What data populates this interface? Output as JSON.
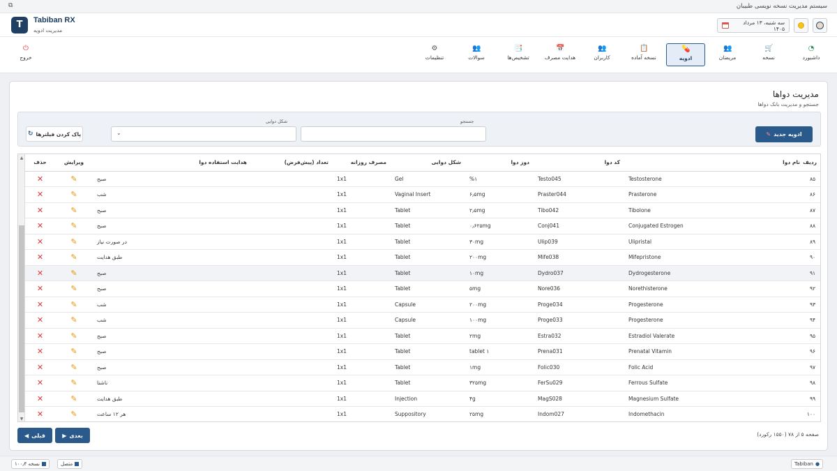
{
  "window": {
    "title": "سیستم مدیریت نسخه نویسی طبیبان",
    "restore_glyph": "⧉"
  },
  "app": {
    "logo_letter": "T",
    "name": "Tabiban RX",
    "subtitle": "مدیریت ادویه"
  },
  "header": {
    "date": "سه شنبه، ۱۳ مرداد ۱۴۰۵"
  },
  "nav": {
    "items": [
      {
        "label": "داشبورد",
        "icon": "gauge-icon",
        "glyph": "◔",
        "color": "#2a8a5a"
      },
      {
        "label": "نسخه",
        "icon": "cart-icon",
        "glyph": "🛒",
        "color": "#2a8a5a"
      },
      {
        "label": "مریضان",
        "icon": "patients-icon",
        "glyph": "👥",
        "color": "#b07a2a"
      },
      {
        "label": "ادویه",
        "icon": "pill-icon",
        "glyph": "💊",
        "color": "#d9534f",
        "active": true
      },
      {
        "label": "نسخه آماده",
        "icon": "prescription-icon",
        "glyph": "📋",
        "color": "#4a6fa5"
      },
      {
        "label": "کاربران",
        "icon": "users-icon",
        "glyph": "👥",
        "color": "#b07a2a"
      },
      {
        "label": "هدایت مصرف",
        "icon": "calendar-icon",
        "glyph": "📅",
        "color": "#d9534f"
      },
      {
        "label": "تشخیص‌ها",
        "icon": "diagnosis-icon",
        "glyph": "📑",
        "color": "#d9534f"
      },
      {
        "label": "سوالات",
        "icon": "questions-icon",
        "glyph": "👥",
        "color": "#b07a2a"
      },
      {
        "label": "تنظیمات",
        "icon": "gear-icon",
        "glyph": "⚙",
        "color": "#555"
      }
    ],
    "logout": {
      "label": "خروج",
      "icon": "power-icon",
      "glyph": "⏻",
      "color": "#e23838"
    }
  },
  "page": {
    "title": "مدیریت دواها",
    "subtitle": "جستجو و مدیریت بانک دواها"
  },
  "filters": {
    "new_button": "ادویه جدید",
    "search_label": "جستجو",
    "search_value": "",
    "form_label": "شکل دوایی",
    "form_value": "",
    "clear_button": "پاک کردن فیلترها"
  },
  "table": {
    "headers": [
      "ردیف",
      "نام دوا",
      "کد دوا",
      "دوز دوا",
      "شکل دوایی",
      "مصرف روزانه",
      "تعداد (پیش‌فرض)",
      "هدایت استفاده دوا",
      "ویرایش",
      "حذف"
    ],
    "rows": [
      [
        "۸۵",
        "Testosterone",
        "Testo045",
        "%۱",
        "Gel",
        "1x1",
        "",
        "صبح"
      ],
      [
        "۸۶",
        "Prasterone",
        "Praster044",
        "۶٫۵mg",
        "Vaginal Insert",
        "1x1",
        "",
        "شب"
      ],
      [
        "۸۷",
        "Tibolone",
        "Tibo042",
        "۲٫۵mg",
        "Tablet",
        "1x1",
        "",
        "صبح"
      ],
      [
        "۸۸",
        "Conjugated Estrogen",
        "Conj041",
        "۰٫۶۲۵mg",
        "Tablet",
        "1x1",
        "",
        "صبح"
      ],
      [
        "۸۹",
        "Ulipristal",
        "Ulip039",
        "۳۰mg",
        "Tablet",
        "1x1",
        "",
        "در صورت نیاز"
      ],
      [
        "۹۰",
        "Mifepristone",
        "Mife038",
        "۲۰۰mg",
        "Tablet",
        "1x1",
        "",
        "طبق هدایت"
      ],
      [
        "۹۱",
        "Dydrogesterone",
        "Dydro037",
        "۱۰mg",
        "Tablet",
        "1x1",
        "",
        "صبح"
      ],
      [
        "۹۲",
        "Norethisterone",
        "Nore036",
        "۵mg",
        "Tablet",
        "1x1",
        "",
        "صبح"
      ],
      [
        "۹۳",
        "Progesterone",
        "Proge034",
        "۲۰۰mg",
        "Capsule",
        "1x1",
        "",
        "شب"
      ],
      [
        "۹۴",
        "Progesterone",
        "Proge033",
        "۱۰۰mg",
        "Capsule",
        "1x1",
        "",
        "شب"
      ],
      [
        "۹۵",
        "Estradiol Valerate",
        "Estra032",
        "۲mg",
        "Tablet",
        "1x1",
        "",
        "صبح"
      ],
      [
        "۹۶",
        "Prenatal Vitamin",
        "Prena031",
        "tablet ۱",
        "Tablet",
        "1x1",
        "",
        "صبح"
      ],
      [
        "۹۷",
        "Folic Acid",
        "Folic030",
        "۱mg",
        "Tablet",
        "1x1",
        "",
        "صبح"
      ],
      [
        "۹۸",
        "Ferrous Sulfate",
        "FerSu029",
        "۳۲۵mg",
        "Tablet",
        "1x1",
        "",
        "ناشتا"
      ],
      [
        "۹۹",
        "Magnesium Sulfate",
        "MagS028",
        "۴g",
        "Injection",
        "1x1",
        "",
        "طبق هدایت"
      ],
      [
        "۱۰۰",
        "Indomethacin",
        "Indom027",
        "۲۵mg",
        "Suppository",
        "1x1",
        "",
        "هر ۱۲ ساعت"
      ]
    ],
    "highlighted_row": 6,
    "edit_glyph": "✎",
    "delete_glyph": "✕"
  },
  "pagination": {
    "next": "بعدی",
    "prev": "قبلی",
    "info": "صفحه ۵ از ۷۸ (۱۵۵۰ رکورد)"
  },
  "status": {
    "user": "Tabiban",
    "connection": "متصل",
    "version": "نسخه ۱۰۰٫۴"
  }
}
